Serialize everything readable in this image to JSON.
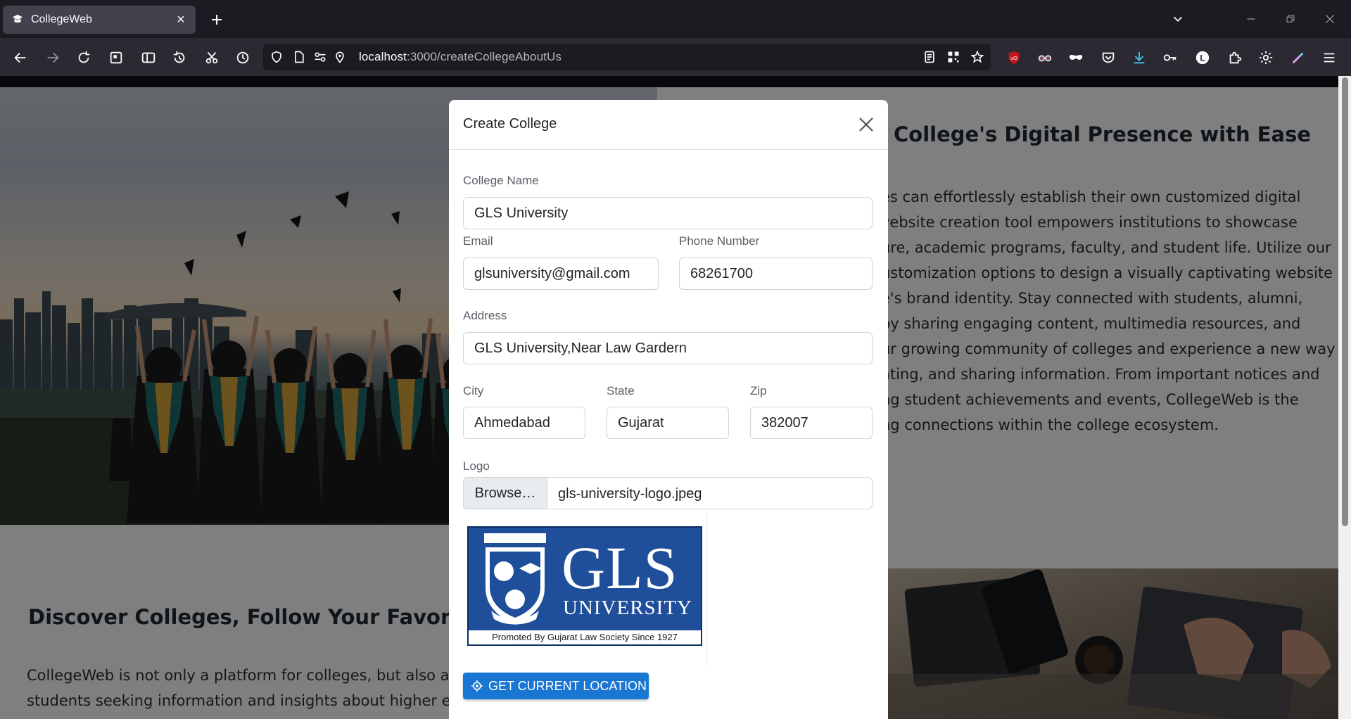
{
  "browser": {
    "tab_title": "CollegeWeb",
    "tab_close": "×",
    "url_host": "localhost",
    "url_path": ":3000/createCollegeAboutUs"
  },
  "page": {
    "heading_top": "College's Digital Presence with Ease",
    "para_top": [
      "es can effortlessly establish their own customized digital",
      "vebsite creation tool empowers institutions to showcase",
      "ure, academic programs, faculty, and student life. Utilize our",
      "ustomization options to design a visually captivating website",
      "e's brand identity. Stay connected with students, alumni,",
      " by sharing engaging content, multimedia resources, and",
      "ur growing community of colleges and experience a new way",
      "ating, and sharing information. From important notices and",
      "ng student achievements and events, CollegeWeb is the",
      "ng connections within the college ecosystem."
    ],
    "heading_bottom": "Discover Colleges, Follow Your Favorites, a",
    "para_bottom": [
      "CollegeWeb is not only a platform for colleges, but also a",
      "students seeking information and insights about higher ec"
    ]
  },
  "modal": {
    "title": "Create College",
    "college_name_label": "College Name",
    "college_name_value": "GLS University",
    "email_label": "Email",
    "email_value": "glsuniversity@gmail.com",
    "phone_label": "Phone Number",
    "phone_value": "68261700",
    "address_label": "Address",
    "address_value": "GLS University,Near Law Gardern",
    "city_label": "City",
    "city_value": "Ahmedabad",
    "state_label": "State",
    "state_value": "Gujarat",
    "zip_label": "Zip",
    "zip_value": "382007",
    "logo_label": "Logo",
    "browse_label": "Browse…",
    "file_name": "gls-university-logo.jpeg",
    "logo_text_main": "GLS",
    "logo_text_sub": "UNIVERSITY",
    "logo_text_strip": "Promoted By Gujarat Law Society Since 1927",
    "location_button": "GET CURRENT LOCATION"
  },
  "colors": {
    "primary_button": "#1976d2",
    "chrome_dark": "#1c1b22",
    "toolbar": "#2b2a33"
  }
}
